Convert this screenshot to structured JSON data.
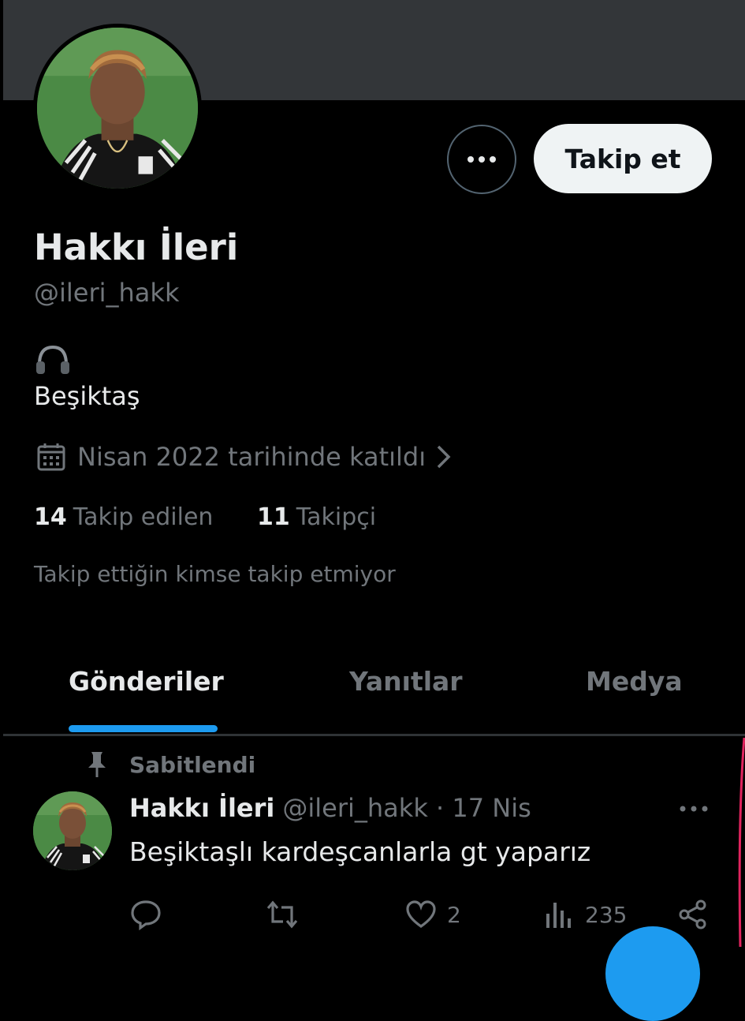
{
  "profile": {
    "display_name": "Hakkı İleri",
    "handle": "@ileri_hakk",
    "bio": "Beşiktaş",
    "bio_icon": "headphones-icon",
    "joined": "Nisan 2022 tarihinde katıldı",
    "following_count": "14",
    "following_label": "Takip edilen",
    "followers_count": "11",
    "followers_label": "Takipçi",
    "mutuals_note": "Takip ettiğin kimse takip etmiyor"
  },
  "actions": {
    "follow_label": "Takip et",
    "more_icon": "more-icon"
  },
  "tabs": [
    {
      "label": "Gönderiler",
      "active": true
    },
    {
      "label": "Yanıtlar",
      "active": false
    },
    {
      "label": "Medya",
      "active": false
    }
  ],
  "tweet": {
    "pinned_label": "Sabitlendi",
    "author_name": "Hakkı İleri",
    "author_meta": "@ileri_hakk · 17 Nis",
    "text": "Beşiktaşlı kardeşcanlarla gt yaparız",
    "likes": "2",
    "views": "235"
  },
  "colors": {
    "accent": "#1d9bf0",
    "background": "#000000",
    "banner": "#333639",
    "muted_text": "#71767b",
    "primary_text": "#e7e9ea"
  }
}
